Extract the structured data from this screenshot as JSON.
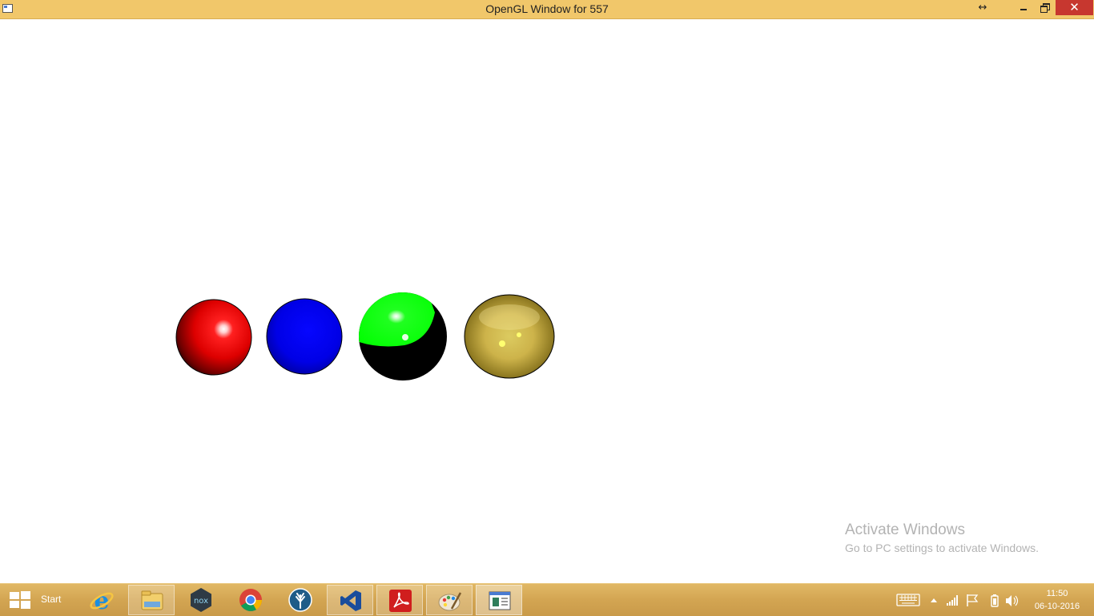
{
  "window": {
    "title": "OpenGL Window for 557",
    "resize_glyph": "↔",
    "close_glyph": "✕"
  },
  "scene": {
    "spheres": [
      {
        "name": "red-sphere",
        "color": "#ff0000"
      },
      {
        "name": "blue-sphere",
        "color": "#0000ff"
      },
      {
        "name": "green-black-sphere",
        "color": "#00ff00"
      },
      {
        "name": "gold-sphere",
        "color": "#c8b040"
      }
    ]
  },
  "watermark": {
    "line1": "Activate Windows",
    "line2": "Go to PC settings to activate Windows."
  },
  "taskbar": {
    "start_label": "Start",
    "apps": [
      {
        "icon": "internet-explorer-icon"
      },
      {
        "icon": "file-explorer-icon"
      },
      {
        "icon": "nox-player-icon",
        "text": "nox"
      },
      {
        "icon": "chrome-icon"
      },
      {
        "icon": "tree-app-icon"
      },
      {
        "icon": "visual-studio-icon"
      },
      {
        "icon": "adobe-reader-icon"
      },
      {
        "icon": "paint-icon"
      },
      {
        "icon": "opengl-window-icon"
      }
    ],
    "clock_time": "11:50",
    "clock_date": "06-10-2016"
  }
}
